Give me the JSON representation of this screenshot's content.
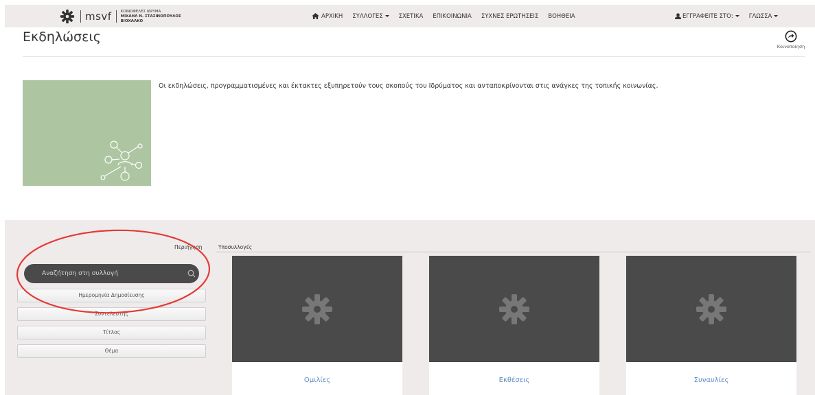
{
  "navbar": {
    "brand_name": "msvf",
    "brand_org": [
      "ΚΟΙΝΩΦΕΛΕΣ ΙΔΡΥΜΑ",
      "ΜΙΧΑΗΛ Ν. ΣΤΑΣΙΝΟΠΟΥΛΟΣ",
      "ΒΙΟΧΑΛΚΟ"
    ],
    "menu": [
      "ΑΡΧΙΚΗ",
      "ΣΥΛΛΟΓΕΣ",
      "ΣΧΕΤΙΚΑ",
      "ΕΠΙΚΟΙΝΩΝΙΑ",
      "ΣΥΧΝΕΣ ΕΡΩΤΗΣΕΙΣ",
      "ΒΟΗΘΕΙΑ"
    ],
    "signin": "ΕΓΓΡΑΦΕΙΤΕ ΣΤΟ:",
    "language": "ΓΛΩΣΣΑ"
  },
  "page": {
    "title": "Εκδηλώσεις",
    "share_label": "Κοινοποίηση",
    "description": "Οι εκδηλώσεις, προγραμματισμένες και έκτακτες εξυπηρετούν τους σκοπούς του Ιδρύματος και ανταποκρίνονται στις ανάγκες της τοπικής κοινωνίας."
  },
  "collection": {
    "tab_overview": "Περιήγηση",
    "tab_subcollections": "Υποσυλλογές",
    "search_placeholder": "Αναζήτηση στη συλλογή",
    "sort_buttons": [
      "Ημερομηνία Δημοσίευσης",
      "Συντελεστής",
      "Τίτλος",
      "Θέμα"
    ],
    "cards": [
      "Ομιλίες",
      "Εκθέσεις",
      "Συναυλίες"
    ]
  },
  "colors": {
    "navbar_bg": "#efebeb",
    "thumb_bg": "#adc5a1",
    "card_img_bg": "#4a4a4a",
    "link": "#5b8cc4",
    "annotation": "#e53935"
  }
}
